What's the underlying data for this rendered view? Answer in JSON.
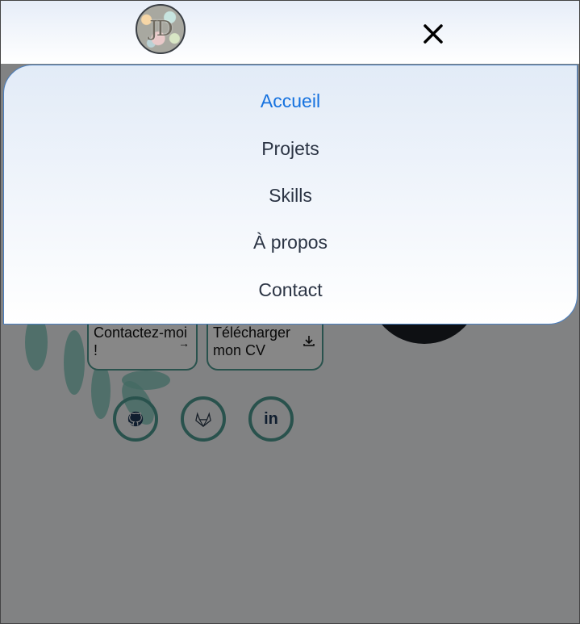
{
  "header": {
    "logo_text": "JD",
    "close_icon": "close-icon"
  },
  "menu": {
    "items": [
      {
        "label": "Accueil",
        "active": true
      },
      {
        "label": "Projets",
        "active": false
      },
      {
        "label": "Skills",
        "active": false
      },
      {
        "label": "À propos",
        "active": false
      },
      {
        "label": "Contact",
        "active": false
      }
    ],
    "active_color": "#1672df"
  },
  "hero": {
    "contact_button": {
      "label": "Contactez-moi !",
      "icon": "arrow-right-icon"
    },
    "cv_button": {
      "label": "Télécharger mon CV",
      "icon": "download-icon"
    },
    "socials": [
      {
        "name": "github",
        "icon": "github-icon"
      },
      {
        "name": "gitlab",
        "icon": "gitlab-icon"
      },
      {
        "name": "linkedin",
        "icon": "linkedin-icon"
      }
    ]
  },
  "colors": {
    "accent": "#4e9c92",
    "menu_border": "#4a7fc0",
    "overlay": "rgba(0,0,0,0.47)"
  }
}
